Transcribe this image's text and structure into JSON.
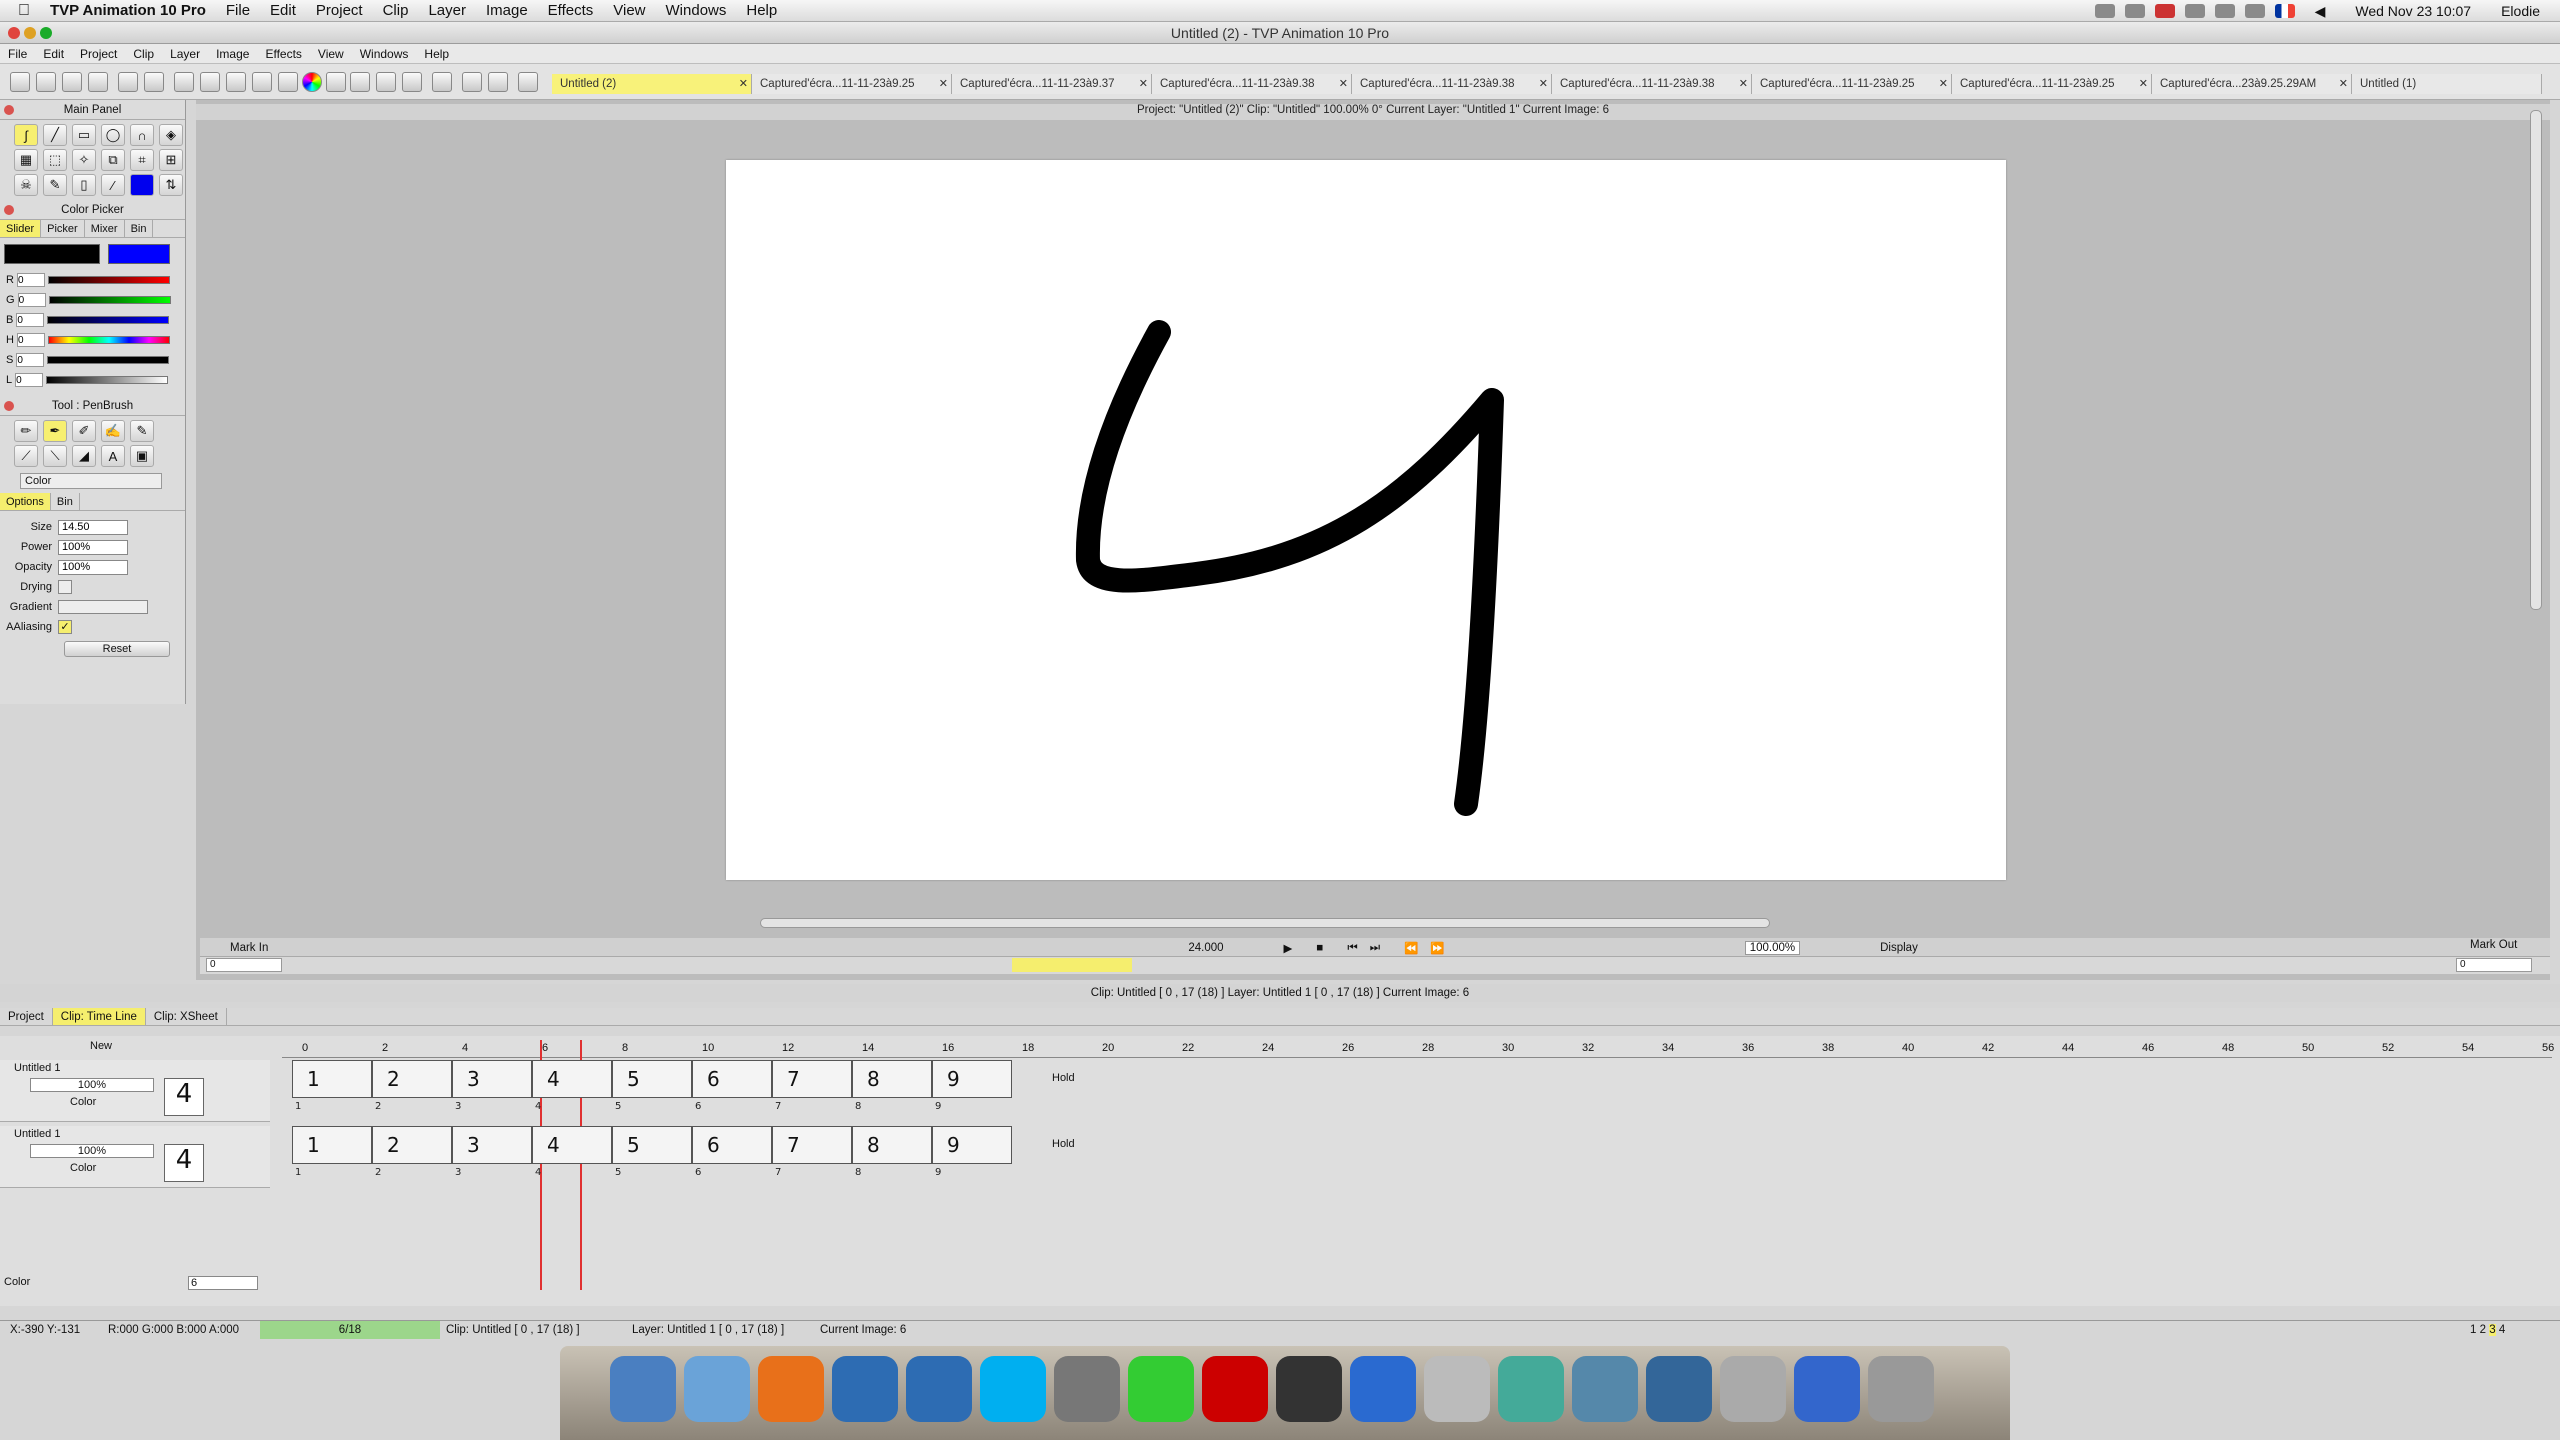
{
  "mac_menu": {
    "app": "TVP Animation 10 Pro",
    "items": [
      "File",
      "Edit",
      "Project",
      "Clip",
      "Layer",
      "Image",
      "Effects",
      "View",
      "Windows",
      "Help"
    ],
    "clock": "Wed Nov 23  10:07",
    "user": "Elodie"
  },
  "window_title": "Untitled (2) - TVP Animation 10 Pro",
  "app_menu": [
    "File",
    "Edit",
    "Project",
    "Clip",
    "Layer",
    "Image",
    "Effects",
    "View",
    "Windows",
    "Help"
  ],
  "doc_tabs": [
    "Untitled (2)",
    "Captured'écra...11-11-23à9.25",
    "Captured'écra...11-11-23à9.37",
    "Captured'écra...11-11-23à9.38",
    "Captured'écra...11-11-23à9.38",
    "Captured'écra...11-11-23à9.38",
    "Captured'écra...11-11-23à9.25",
    "Captured'écra...11-11-23à9.25",
    "Captured'écra...23à9.25.29AM",
    "Untitled (1)"
  ],
  "main_panel": {
    "title": "Main Panel"
  },
  "color_picker": {
    "title": "Color Picker",
    "tabs": [
      "Slider",
      "Picker",
      "Mixer",
      "Bin"
    ],
    "rows": [
      {
        "k": "R",
        "v": "0"
      },
      {
        "k": "G",
        "v": "0"
      },
      {
        "k": "B",
        "v": "0"
      },
      {
        "k": "H",
        "v": "0"
      },
      {
        "k": "S",
        "v": "0"
      },
      {
        "k": "L",
        "v": "0"
      }
    ]
  },
  "tool_panel": {
    "title": "Tool : PenBrush",
    "mode": "Color",
    "tabs": [
      "Options",
      "Bin"
    ],
    "size_label": "Size",
    "size": "14.50",
    "power_label": "Power",
    "power": "100%",
    "opacity_label": "Opacity",
    "opacity": "100%",
    "drying_label": "Drying",
    "gradient_label": "Gradient",
    "aaliasing_label": "AAliasing",
    "reset": "Reset"
  },
  "info_bar": "Project: \"Untitled (2)\" Clip: \"Untitled\"   100.00%   0°   Current Layer: \"Untitled 1\"   Current Image: 6",
  "playback": {
    "mark_in": "Mark In",
    "mark_out": "Mark Out",
    "fps": "24.000",
    "zoom": "100.00%",
    "display": "Display",
    "in_val": "0",
    "out_val": "0"
  },
  "status_mid": "Clip: Untitled [ 0 , 17  (18) ]        Layer: Untitled 1 [ 0 , 17  (18) ]      Current Image: 6",
  "bottom_tabs": [
    "Project",
    "Clip: Time Line",
    "Clip: XSheet"
  ],
  "timeline": {
    "new_label": "New",
    "layers": [
      {
        "name": "Untitled 1",
        "opacity": "100%",
        "mode": "Color",
        "hold": "Hold"
      },
      {
        "name": "Untitled 1",
        "opacity": "100%",
        "mode": "Color",
        "hold": "Hold"
      }
    ],
    "ruler": [
      "0",
      "2",
      "4",
      "6",
      "8",
      "10",
      "12",
      "14",
      "16",
      "18",
      "20",
      "22",
      "24",
      "26",
      "28",
      "30",
      "32",
      "34",
      "36",
      "38",
      "40",
      "42",
      "44",
      "46",
      "48",
      "50",
      "52",
      "54",
      "56"
    ],
    "frame_glyphs": [
      "1",
      "2",
      "3",
      "4",
      "5",
      "6",
      "7",
      "8",
      "9"
    ],
    "frame_numbers": [
      "1",
      "2",
      "3",
      "4",
      "5",
      "6",
      "7",
      "8",
      "9"
    ],
    "color_label": "Color",
    "frame_field": "6"
  },
  "bottom_status": {
    "coords": "X:-390  Y:-131",
    "rgba": "R:000 G:000 B:000 A:000",
    "progress": "6/18",
    "clip": "Clip: Untitled [ 0 , 17  (18) ]",
    "layer": "Layer: Untitled 1 [ 0 , 17  (18) ]",
    "image": "Current Image: 6",
    "pages": [
      "1",
      "2",
      "3",
      "4"
    ]
  },
  "canvas_glyph": "4",
  "dock_apps": [
    "Finder",
    "Mail",
    "Firefox",
    "TVP",
    "TVP",
    "Skype",
    "System Preferences",
    "Growl",
    "FileZilla",
    "Activity Monitor",
    "iTunes",
    "Label Print",
    "Messenger",
    "HP",
    "VirtualBox",
    "Preview",
    "Thunderbird",
    "Trash"
  ]
}
